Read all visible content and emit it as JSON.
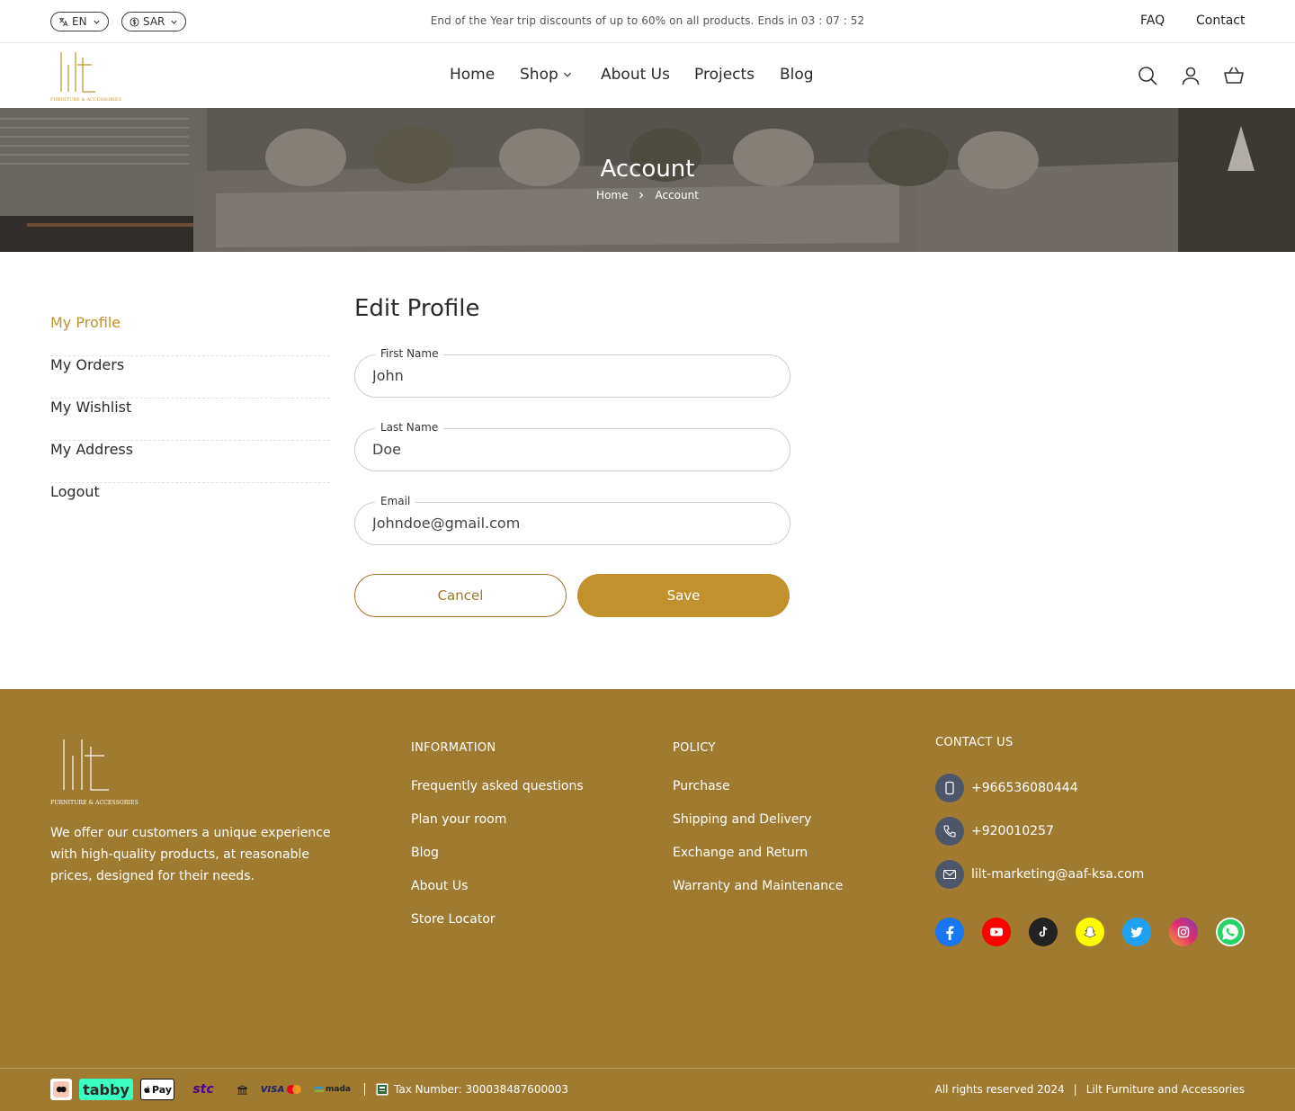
{
  "topbar": {
    "language": "EN",
    "currency": "SAR",
    "promo": "End of the Year trip discounts of up to 60% on all products. Ends in 03 : 07 : 52",
    "faq": "FAQ",
    "contact": "Contact"
  },
  "brand": {
    "logo_text": "lilt",
    "logo_sub": "FURNITURE & ACCESSORIES"
  },
  "nav": {
    "home": "Home",
    "shop": "Shop",
    "about": "About Us",
    "projects": "Projects",
    "blog": "Blog"
  },
  "hero": {
    "title": "Account",
    "crumb_home": "Home",
    "crumb_current": "Account"
  },
  "sidebar": {
    "items": [
      {
        "label": "My Profile"
      },
      {
        "label": "My Orders"
      },
      {
        "label": "My Wishlist"
      },
      {
        "label": "My Address"
      },
      {
        "label": "Logout"
      }
    ]
  },
  "form": {
    "title": "Edit Profile",
    "first_name": {
      "label": "First Name",
      "value": "John"
    },
    "last_name": {
      "label": "Last Name",
      "value": "Doe"
    },
    "email": {
      "label": "Email",
      "value": "Johndoe@gmail.com"
    },
    "cancel": "Cancel",
    "save": "Save"
  },
  "footer": {
    "about": "We offer our customers a unique experience with high-quality products, at reasonable prices, designed for their needs.",
    "information": {
      "heading": "INFORMATION",
      "links": [
        "Frequently asked questions",
        "Plan your room",
        "Blog",
        "About Us",
        "Store Locator"
      ]
    },
    "policy": {
      "heading": "POLICY",
      "links": [
        "Purchase",
        "Shipping and Delivery",
        "Exchange and Return",
        "Warranty and Maintenance"
      ]
    },
    "contact": {
      "heading": "CONTACT US",
      "mobile": "+966536080444",
      "phone": "+920010257",
      "email": "lilt-marketing@aaf-ksa.com"
    },
    "social": [
      "facebook-icon",
      "youtube-icon",
      "tiktok-icon",
      "snapchat-icon",
      "twitter-icon",
      "instagram-icon",
      "whatsapp-icon"
    ],
    "payments": {
      "tabby": "tabby",
      "applepay": "Pay",
      "stc": "stc",
      "visa": "VISA",
      "mada": "mada"
    },
    "tax": "Tax Number: 300038487600003",
    "rights": "All rights reserved 2024",
    "company": "Lilt Furniture and Accessories"
  },
  "colors": {
    "accent": "#c0912d",
    "footer_bg": "#a07a31",
    "contact_icon_bg": "#4d5568"
  }
}
